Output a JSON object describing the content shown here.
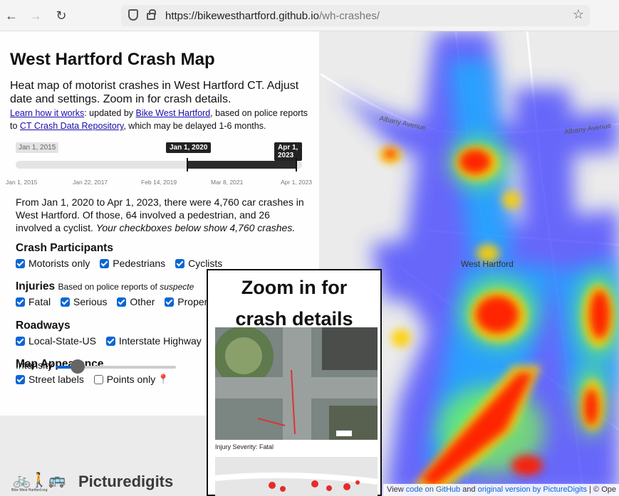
{
  "browser": {
    "url_host": "https://bikewesthartford.github.io",
    "url_path": "/wh-crashes/"
  },
  "panel": {
    "title": "West Hartford Crash Map",
    "description": "Heat map of motorist crashes in West Hartford CT. Adjust date and settings. Zoom in for crash details.",
    "credits": {
      "learn_link": "Learn how it works",
      "text1": ": updated by ",
      "bike_link": "Bike West Hartford",
      "text2": ", based on police reports to ",
      "ct_link": "CT Crash Data Repository",
      "text3": ", which may be delayed 1-6 months."
    }
  },
  "slider": {
    "start_chip": "Jan 1, 2015",
    "from_value": "Jan 1, 2020",
    "to_value": "Apr 1, 2023",
    "from_fraction": 0.6,
    "to_fraction": 0.98,
    "ticks": [
      "Jan 1, 2015",
      "Jan 22, 2017",
      "Feb 14, 2019",
      "Mar 8, 2021",
      "Apr 1, 2023"
    ]
  },
  "summary": {
    "text": "From Jan 1, 2020 to Apr 1, 2023, there were 4,760 car crashes in West Hartford. Of those, 64 involved a pedestrian, and 26 involved a cyclist. ",
    "italic": "Your checkboxes below show 4,760 crashes."
  },
  "participants": {
    "title": "Crash Participants",
    "items": [
      {
        "label": "Motorists only",
        "checked": true
      },
      {
        "label": "Pedestrians",
        "checked": true
      },
      {
        "label": "Cyclists",
        "checked": true
      }
    ]
  },
  "injuries": {
    "title": "Injuries",
    "note": "Based on police reports of ",
    "note_italic": "suspecte",
    "items": [
      {
        "label": "Fatal",
        "checked": true
      },
      {
        "label": "Serious",
        "checked": true
      },
      {
        "label": "Other",
        "checked": true
      },
      {
        "label": "Property",
        "checked": true
      }
    ]
  },
  "roadways": {
    "title": "Roadways",
    "items": [
      {
        "label": "Local-State-US",
        "checked": true
      },
      {
        "label": "Interstate Highway",
        "checked": true
      }
    ]
  },
  "appearance": {
    "title": "Map Appearance",
    "street_labels": "Street labels",
    "points_only": "Points only",
    "intensity_label": "Intensity",
    "intensity_fraction": 0.18
  },
  "logos": {
    "bike_sub": "Bike West Hartford.org",
    "picturedigits": "Picturedigits"
  },
  "zoom_popup": {
    "title_line1": "Zoom in for",
    "title_line2": "crash details",
    "severity": "Injury Severity: Fatal"
  },
  "map": {
    "place": "West Hartford",
    "road1": "Albany Avenue",
    "road2": "Albany Avenue"
  },
  "attribution": {
    "view": "View ",
    "code_link": "code on GitHub",
    "and": " and ",
    "orig_link": "original version by PictureDigits",
    "rest": " | © Ope"
  }
}
